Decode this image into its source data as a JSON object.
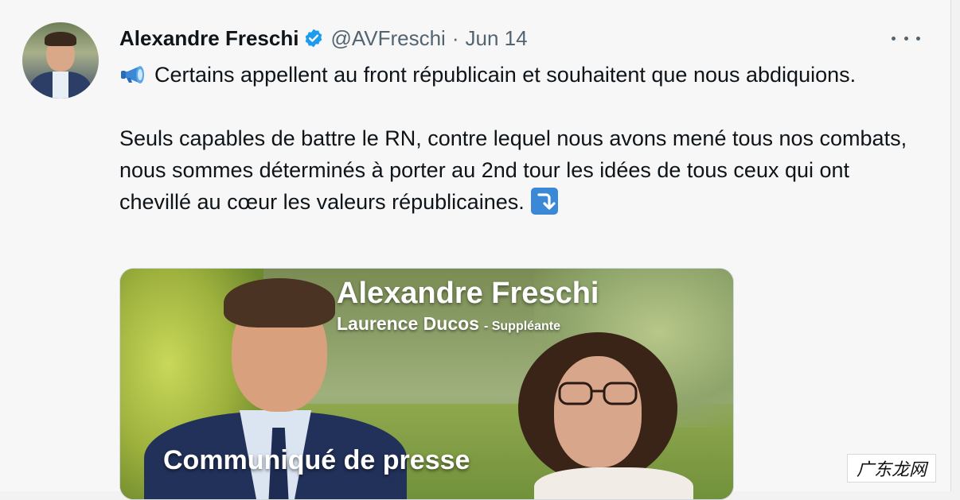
{
  "tweet": {
    "author_name": "Alexandre Freschi",
    "handle": "@AVFreschi",
    "separator": "·",
    "date": "Jun 14",
    "line1": "Certains appellent au front républicain et souhaitent que nous abdiquions.",
    "line2": "Seuls capables de battre le RN, contre lequel nous avons mené tous nos combats, nous sommes déterminés à porter au 2nd tour les idées de tous ceux qui ont chevillé au cœur les valeurs républicaines."
  },
  "media": {
    "title": "Alexandre Freschi",
    "subtitle_name": "Laurence Ducos",
    "subtitle_role": "- Suppléante",
    "caption": "Communiqué de presse"
  },
  "watermark": "广东龙网",
  "icons": {
    "verified": "verified-badge-icon",
    "more": "more-options-icon",
    "megaphone": "megaphone-emoji",
    "arrow": "right-arrow-curving-down-emoji"
  },
  "colors": {
    "verified_blue": "#1d9bf0",
    "text_primary": "#0f1419",
    "text_secondary": "#536471"
  }
}
